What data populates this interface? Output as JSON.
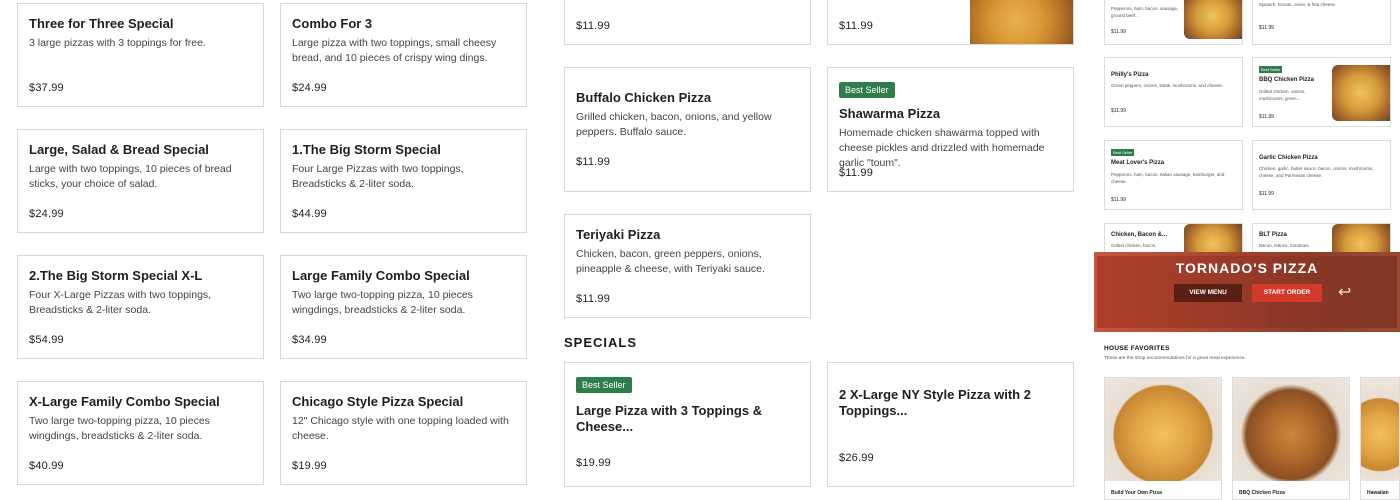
{
  "col1": [
    {
      "title": "Three for Three Special",
      "desc": "3 large pizzas with 3 toppings for free.",
      "price": "$37.99"
    },
    {
      "title": "Large, Salad & Bread Special",
      "desc": "Large with two toppings, 10 pieces of bread sticks, your choice of salad.",
      "price": "$24.99"
    },
    {
      "title": "2.The Big Storm Special X-L",
      "desc": "Four X-Large Pizzas with two toppings, Breadsticks & 2-liter soda.",
      "price": "$54.99"
    },
    {
      "title": "X-Large Family Combo Special",
      "desc": "Two large two-topping pizza, 10 pieces wingdings, breadsticks & 2-liter soda.",
      "price": "$40.99"
    }
  ],
  "col2": [
    {
      "title": "Combo For 3",
      "desc": "Large pizza with two toppings, small cheesy bread, and 10 pieces of crispy wing dings.",
      "price": "$24.99"
    },
    {
      "title": "1.The Big Storm Special",
      "desc": "Four Large Pizzas with two toppings, Breadsticks & 2-liter soda.",
      "price": "$44.99"
    },
    {
      "title": "Large Family Combo Special",
      "desc": "Two large two-topping pizza, 10 pieces wingdings, breadsticks & 2-liter soda.",
      "price": "$34.99"
    },
    {
      "title": "Chicago Style Pizza Special",
      "desc": "12\" Chicago style with one topping loaded with cheese.",
      "price": "$19.99"
    }
  ],
  "col3": {
    "top_price": "$11.99",
    "buffalo": {
      "title": "Buffalo Chicken Pizza",
      "desc": "Grilled chicken, bacon, onions, and yellow peppers. Buffalo sauce.",
      "price": "$11.99"
    },
    "teriyaki": {
      "title": "Teriyaki Pizza",
      "desc": "Chicken, bacon, green peppers, onions, pineapple & cheese, with Teriyaki sauce.",
      "price": "$11.99"
    },
    "special1": {
      "badge": "Best Seller",
      "title": "Large Pizza with 3 Toppings & Cheese...",
      "price": "$19.99"
    }
  },
  "col4": {
    "top_price": "$11.99",
    "shawarma": {
      "badge": "Best Seller",
      "title": "Shawarma Pizza",
      "desc": "Homemade chicken shawarma topped with cheese pickles and drizzled with homemade garlic \"toum\".",
      "price": "$11.99"
    },
    "special2": {
      "title": "2 X-Large NY Style Pizza with 2 Toppings...",
      "price": "$26.99"
    }
  },
  "section_heading": "SPECIALS",
  "preview": {
    "minis": [
      {
        "title": "",
        "desc": "Pepperoni, ham, bacon, sausage, ground beef...",
        "price": "$11.99",
        "badge": ""
      },
      {
        "title": "",
        "desc": "Spinach, tomato, onion, & feta cheese.",
        "price": "$11.99",
        "badge": ""
      },
      {
        "title": "Philly's Pizza",
        "desc": "Green peppers, onions, steak, mushrooms, and cheese.",
        "price": "$11.99",
        "badge": ""
      },
      {
        "title": "BBQ Chicken Pizza",
        "desc": "Grilled chicken, onions, mushrooms, green...",
        "price": "$11.99",
        "badge": "Best Seller"
      },
      {
        "title": "Meat Lover's Pizza",
        "desc": "Pepperoni, ham, bacon, Italian sausage, hamburger, and cheese.",
        "price": "$11.99",
        "badge": "Best Seller"
      },
      {
        "title": "Garlic Chicken Pizza",
        "desc": "Chicken, garlic, butter sauce, bacon, onions, mushrooms, cheese, and Parmesan cheese.",
        "price": "$11.99",
        "badge": ""
      },
      {
        "title": "Chicken, Bacon &...",
        "desc": "Grilled chicken, bacon,",
        "price": "",
        "badge": ""
      },
      {
        "title": "BLT Pizza",
        "desc": "Bacon, lettuce, tomatoes,",
        "price": "",
        "badge": ""
      }
    ],
    "hero": {
      "title": "TORNADO'S PIZZA",
      "view_menu": "VIEW MENU",
      "start_order": "START ORDER"
    },
    "house_title": "HOUSE FAVORITES",
    "house_sub": "These are the shop recommendations for a great meal experience.",
    "house_items": [
      "Build Your Own Pizza",
      "BBQ Chicken Pizza",
      "Hawaiian"
    ]
  }
}
